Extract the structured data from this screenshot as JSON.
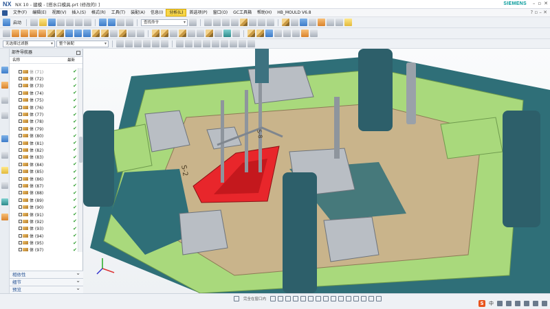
{
  "title": {
    "logo": "NX",
    "text": "NX 10 - 建模 - [搭水口模具.prt  (修改的) ]",
    "brand": "SIEMENS"
  },
  "menu": [
    {
      "label": "文件(F)"
    },
    {
      "label": "编辑(E)"
    },
    {
      "label": "视图(V)"
    },
    {
      "label": "插入(S)"
    },
    {
      "label": "格式(R)"
    },
    {
      "label": "工具(T)"
    },
    {
      "label": "装配(A)"
    },
    {
      "label": "信息(I)"
    },
    {
      "label": "分析(L)",
      "active": true
    },
    {
      "label": "首选项(P)"
    },
    {
      "label": "窗口(O)"
    },
    {
      "label": "GC工具箱"
    },
    {
      "label": "帮助(H)"
    },
    {
      "label": "HB_MOULD V6.8"
    }
  ],
  "toolbar": {
    "start_label": "启动",
    "command_search_placeholder": "查找命令",
    "selection_filter": "无选择过滤器",
    "assembly_scope": "整个装配"
  },
  "navigator": {
    "title": "部件导航器",
    "col_name": "名称",
    "col_latest": "最新",
    "items": [
      {
        "label": "体 (71)",
        "dim": true
      },
      {
        "label": "体 (72)"
      },
      {
        "label": "体 (73)"
      },
      {
        "label": "体 (74)"
      },
      {
        "label": "体 (75)"
      },
      {
        "label": "体 (76)"
      },
      {
        "label": "体 (77)"
      },
      {
        "label": "体 (78)"
      },
      {
        "label": "体 (79)"
      },
      {
        "label": "体 (80)"
      },
      {
        "label": "体 (81)"
      },
      {
        "label": "体 (82)"
      },
      {
        "label": "体 (83)"
      },
      {
        "label": "体 (84)"
      },
      {
        "label": "体 (85)"
      },
      {
        "label": "体 (86)"
      },
      {
        "label": "体 (87)"
      },
      {
        "label": "体 (88)"
      },
      {
        "label": "体 (89)"
      },
      {
        "label": "体 (90)"
      },
      {
        "label": "体 (91)"
      },
      {
        "label": "体 (92)"
      },
      {
        "label": "体 (93)"
      },
      {
        "label": "体 (94)"
      },
      {
        "label": "体 (95)"
      },
      {
        "label": "体 (97)"
      }
    ],
    "panels": [
      {
        "label": "相依性"
      },
      {
        "label": "细节"
      },
      {
        "label": "预览"
      }
    ]
  },
  "viewport": {
    "face_label_1": "S-2",
    "face_label_2": "S-8",
    "colors": {
      "plate_green": "#a9d97c",
      "plate_tan": "#c9b48b",
      "plate_teal": "#2f6f78",
      "steel_gray": "#b9bec4",
      "pillar_dark": "#2d5f6a",
      "insert_red": "#e8262b"
    }
  },
  "statusbar": {
    "filter_text": "完全在窗口内"
  }
}
